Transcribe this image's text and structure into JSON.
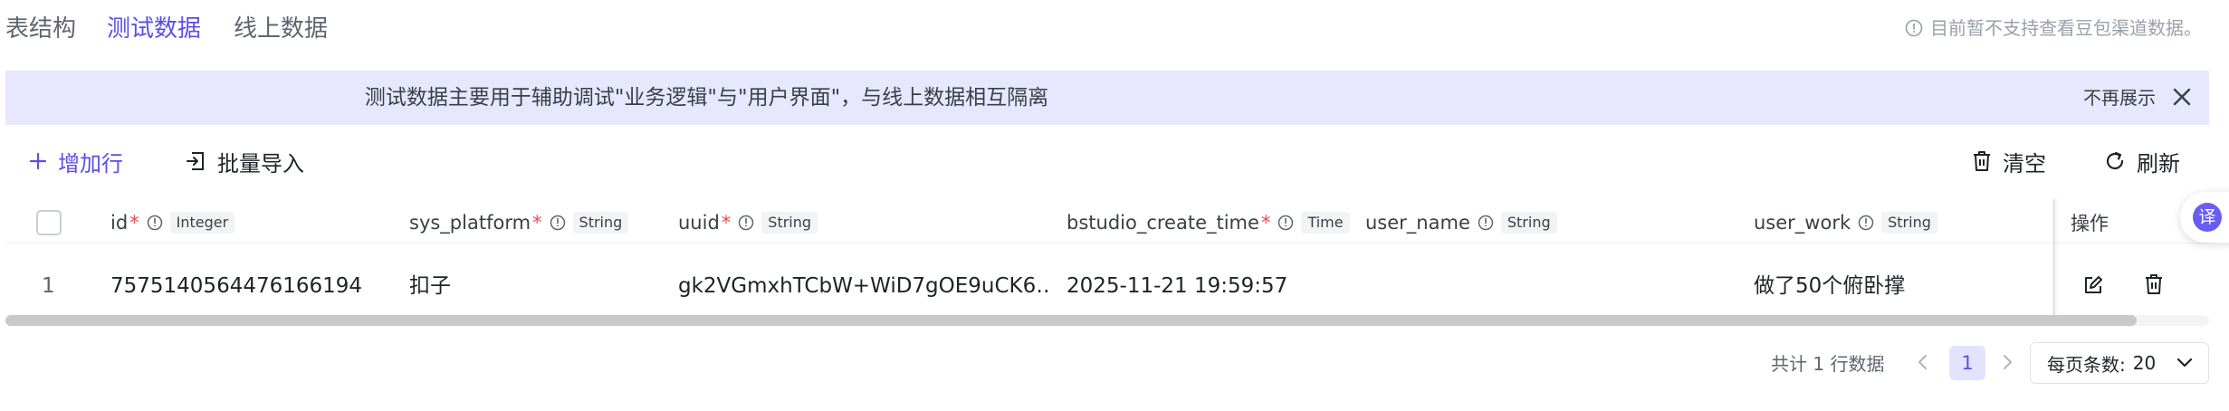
{
  "tabs": [
    {
      "label": "表结构",
      "active": false
    },
    {
      "label": "测试数据",
      "active": true
    },
    {
      "label": "线上数据",
      "active": false
    }
  ],
  "notice": {
    "text": "目前暂不支持查看豆包渠道数据。",
    "icon": "info-circle-icon"
  },
  "banner": {
    "text": "测试数据主要用于辅助调试\"业务逻辑\"与\"用户界面\"，与线上数据相互隔离",
    "dismiss_label": "不再展示",
    "close_icon": "close-icon"
  },
  "toolbar": {
    "add_row_label": "增加行",
    "import_label": "批量导入",
    "clear_label": "清空",
    "refresh_label": "刷新"
  },
  "table": {
    "columns": [
      {
        "name": "id",
        "required": true,
        "type": "Integer"
      },
      {
        "name": "sys_platform",
        "required": true,
        "type": "String"
      },
      {
        "name": "uuid",
        "required": true,
        "type": "String"
      },
      {
        "name": "bstudio_create_time",
        "required": true,
        "type": "Time"
      },
      {
        "name": "user_name",
        "required": false,
        "type": "String"
      },
      {
        "name": "user_work",
        "required": false,
        "type": "String"
      }
    ],
    "required_mark": "*",
    "actions_header": "操作",
    "rows": [
      {
        "index": "1",
        "cells": [
          "7575140564476166194",
          "扣子",
          "gk2VGmxhTCbW+WiD7gOE9uCK6…",
          "2025-11-21 19:59:57",
          "",
          "做了50个俯卧撑"
        ]
      }
    ]
  },
  "pagination": {
    "total_text": "共计 1 行数据",
    "current_page": "1",
    "page_size_label": "每页条数:",
    "page_size_value": "20"
  },
  "fab": {
    "label": "译"
  },
  "colors": {
    "accent": "#5c4ee6",
    "banner_bg": "#e7e7ff",
    "required": "#e34d59"
  }
}
